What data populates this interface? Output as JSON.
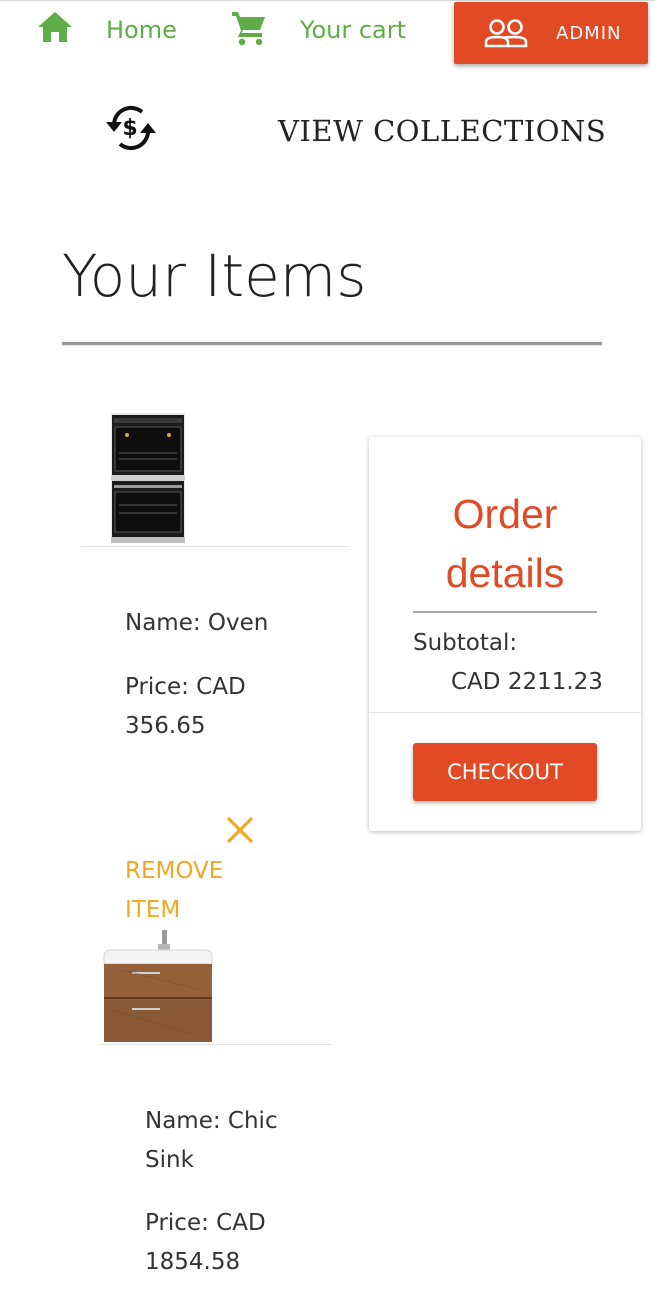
{
  "nav": {
    "home_label": "Home",
    "cart_label": "Your cart",
    "admin_label": "ADMIN",
    "view_collections_label": "VIEW COLLECTIONS"
  },
  "page": {
    "title": "Your Items"
  },
  "items": [
    {
      "name": "Name: Oven",
      "price_line1": "Price: CAD",
      "price_line2": "356.65"
    },
    {
      "name_line1": "Name: Chic",
      "name_line2": "Sink",
      "price_line1": "Price: CAD",
      "price_line2": "1854.58"
    }
  ],
  "remove": {
    "line1": "REMOVE",
    "line2": "ITEM"
  },
  "order": {
    "title_line1": "Order",
    "title_line2": "details",
    "subtotal_label": "Subtotal:",
    "subtotal_value": "CAD 2211.23",
    "checkout_label": "CHECKOUT"
  },
  "colors": {
    "accent": "#e14a24",
    "nav_green": "#5fad46",
    "remove_amber": "#f2a623"
  },
  "icons": {
    "home": "home-icon",
    "cart": "cart-icon",
    "admin": "people-icon",
    "currency": "currency-exchange-icon",
    "remove": "close-icon"
  }
}
